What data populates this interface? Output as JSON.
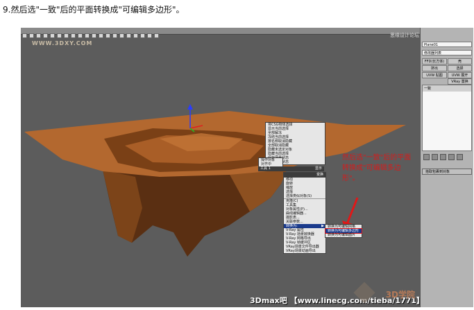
{
  "caption": "9.然后选\"一致\"后的平面转换成\"可编辑多边形\"。",
  "viewport": {
    "watermark_left": "WWW.3DXY.COM",
    "watermark_top": "思缘设计论坛",
    "bottom_credit": "3Dmax吧 【www.linecg.com/tieba/1771】",
    "logo": "3D学院"
  },
  "quad_menu_top": {
    "items": [
      "将CSG物体选择",
      "显示当前选择",
      "全部解冻",
      "冻结当前选择",
      "按名称取消隐藏",
      "全部取消隐藏",
      "隐藏未选定对象",
      "隐藏当前选择",
      "保存场景状态",
      "管理场景状态"
    ],
    "left_items": [
      "操作对象",
      "对齐中"
    ],
    "header_left": "工具 1",
    "header_right": "显示"
  },
  "quad_menu_bottom": {
    "header_right": "变换",
    "items": [
      "移动",
      "旋转",
      "缩放",
      "选择",
      "选择类似对象(S)",
      "克隆(C)",
      "工具集",
      "对象属性(P)...",
      "曲线编辑器...",
      "摄影表...",
      "关联参数...",
      "转换为:",
      "V-Ray 属性",
      "V-Ray 场景转换器",
      "V-Ray 网格导出",
      "V-Ray 帧缓冲区",
      "VRay场景文件导出器",
      "VRay场景动画导出"
    ],
    "highlight_index": 11
  },
  "submenu": {
    "items": [
      "转换为可编辑网格",
      "转换为可编辑多边形",
      "转换为可编辑面片"
    ],
    "highlight_index": 1
  },
  "annotation": "然后选\"一致\"后的平面转换成\"可编辑多边形\"。",
  "panel": {
    "object_name": "Plane01",
    "modifier_list": "修改器列表",
    "btn_ffd": "FFD(长方体)",
    "btn_shell": "壳",
    "btn_extrude": "挤出",
    "btn_select": "选择",
    "btn_uvw_map": "UVW 贴图",
    "btn_uvw_unwrap": "UVW 展开",
    "btn_vray": "VRay 置换",
    "stack_item": "一致",
    "rollout": "拾取包裹到对象"
  },
  "colors": {
    "plane_top": "#b3682f",
    "plane_side": "#6b3a17",
    "annotation": "#d41c1c",
    "highlight": "#1a3a8c"
  }
}
